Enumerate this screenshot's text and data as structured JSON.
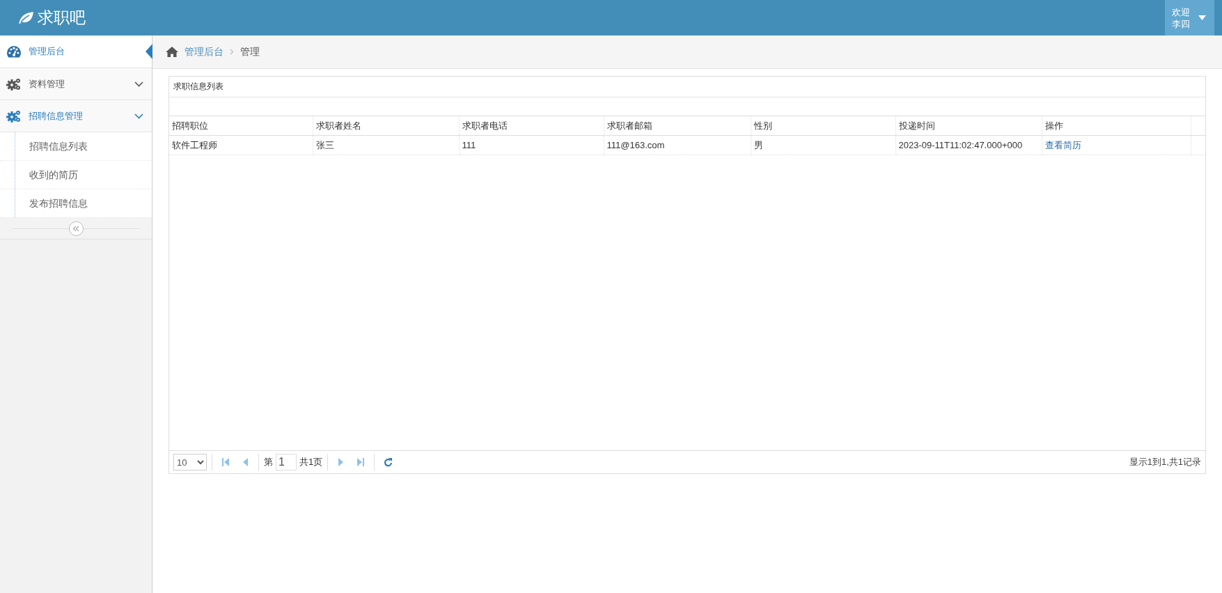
{
  "header": {
    "logo": "求职吧",
    "greeting": "欢迎",
    "user_name": "李四"
  },
  "sidebar": {
    "items": [
      {
        "label": "管理后台",
        "kind": "link",
        "selected": true
      },
      {
        "label": "资料管理",
        "kind": "group",
        "selected": false,
        "expanded": false
      },
      {
        "label": "招聘信息管理",
        "kind": "group",
        "selected": false,
        "expanded": true,
        "children": [
          {
            "label": "招聘信息列表",
            "selected": false
          },
          {
            "label": "收到的简历",
            "selected": false
          },
          {
            "label": "发布招聘信息",
            "selected": false
          }
        ]
      }
    ]
  },
  "breadcrumb": [
    {
      "label": "管理后台",
      "kind": "link"
    },
    {
      "label": "管理",
      "kind": "current"
    }
  ],
  "panel": {
    "title": "求职信息列表",
    "table": {
      "columns": [
        "招聘职位",
        "求职者姓名",
        "求职者电话",
        "求职者邮箱",
        "性别",
        "投递时间",
        "操作"
      ],
      "rows": [
        {
          "cells": [
            "软件工程师",
            "张三",
            "111",
            "111@163.com",
            "男",
            "2023-09-11T11:02:47.000+000"
          ],
          "action": "查看简历"
        }
      ]
    },
    "pager": {
      "page_size": "10",
      "page_prefix": "第",
      "page": "1",
      "page_suffix": "共1页",
      "summary": "显示1到1,共1记录"
    }
  }
}
